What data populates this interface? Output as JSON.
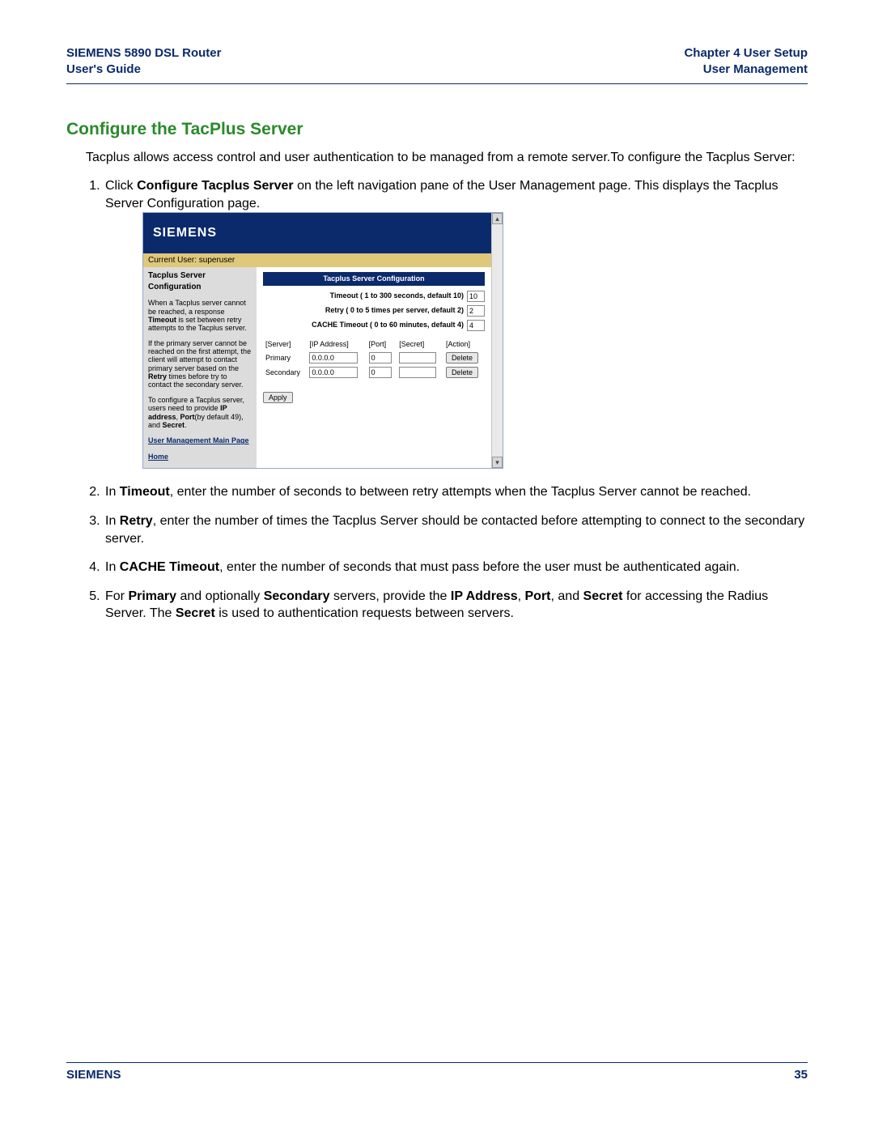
{
  "header": {
    "product": "SIEMENS 5890 DSL Router",
    "subtitle": "User's Guide",
    "chapter": "Chapter 4  User Setup",
    "section": "User Management"
  },
  "title": "Configure the TacPlus Server",
  "intro": "Tacplus allows access control and user authentication to be managed from a remote server.To configure the Tacplus Server:",
  "steps": {
    "s1_a": "Click ",
    "s1_b": "Configure Tacplus Server",
    "s1_c": " on the left navigation pane of the User Management page. This displays the Tacplus Server Configuration page.",
    "s2_a": "In ",
    "s2_b": "Timeout",
    "s2_c": ", enter the number of seconds to between retry attempts when the Tacplus Server cannot be reached.",
    "s3_a": "In ",
    "s3_b": "Retry",
    "s3_c": ", enter the number of times the Tacplus Server should be contacted before attempting to connect to the secondary server.",
    "s4_a": "In ",
    "s4_b": "CACHE Timeout",
    "s4_c": ", enter the number of seconds that must pass before the user must be authenticated again.",
    "s5_a": "For ",
    "s5_b": "Primary",
    "s5_c": " and optionally ",
    "s5_d": "Secondary",
    "s5_e": " servers, provide the ",
    "s5_f": "IP Address",
    "s5_g": ", ",
    "s5_h": "Port",
    "s5_i": ", and ",
    "s5_j": "Secret",
    "s5_k": " for accessing the Radius Server. The ",
    "s5_l": "Secret",
    "s5_m": " is used to authentication requests between servers."
  },
  "shot": {
    "brand": "SIEMENS",
    "userbar": "Current User: superuser",
    "left": {
      "title": "Tacplus Server Configuration",
      "p1a": "When a Tacplus server cannot be reached, a response ",
      "p1b": "Timeout",
      "p1c": " is set between retry attempts to the Tacplus server.",
      "p2a": "If the primary server cannot be reached on the first attempt, the client will attempt to contact primary server based on the ",
      "p2b": "Retry",
      "p2c": " times before try to contact the secondary server.",
      "p3a": "To configure a Tacplus server, users need to provide ",
      "p3b": "IP address",
      "p3c": ", ",
      "p3d": "Port",
      "p3e": "(by default 49), and ",
      "p3f": "Secret",
      "p3g": ".",
      "link1": "User Management Main Page",
      "link2": "Home"
    },
    "main": {
      "header": "Tacplus Server Configuration",
      "timeout_label": "Timeout ( 1 to 300 seconds, default 10)",
      "timeout_val": "10",
      "retry_label": "Retry ( 0 to 5 times per server, default 2)",
      "retry_val": "2",
      "cache_label": "CACHE Timeout ( 0 to 60 minutes, default 4)",
      "cache_val": "4",
      "cols": {
        "server": "[Server]",
        "ip": "[IP Address]",
        "port": "[Port]",
        "secret": "[Secret]",
        "action": "[Action]"
      },
      "rows": [
        {
          "name": "Primary",
          "ip": "0.0.0.0",
          "port": "0",
          "secret": "",
          "action": "Delete"
        },
        {
          "name": "Secondary",
          "ip": "0.0.0.0",
          "port": "0",
          "secret": "",
          "action": "Delete"
        }
      ],
      "apply": "Apply"
    }
  },
  "footer": {
    "brand": "SIEMENS",
    "page": "35"
  }
}
